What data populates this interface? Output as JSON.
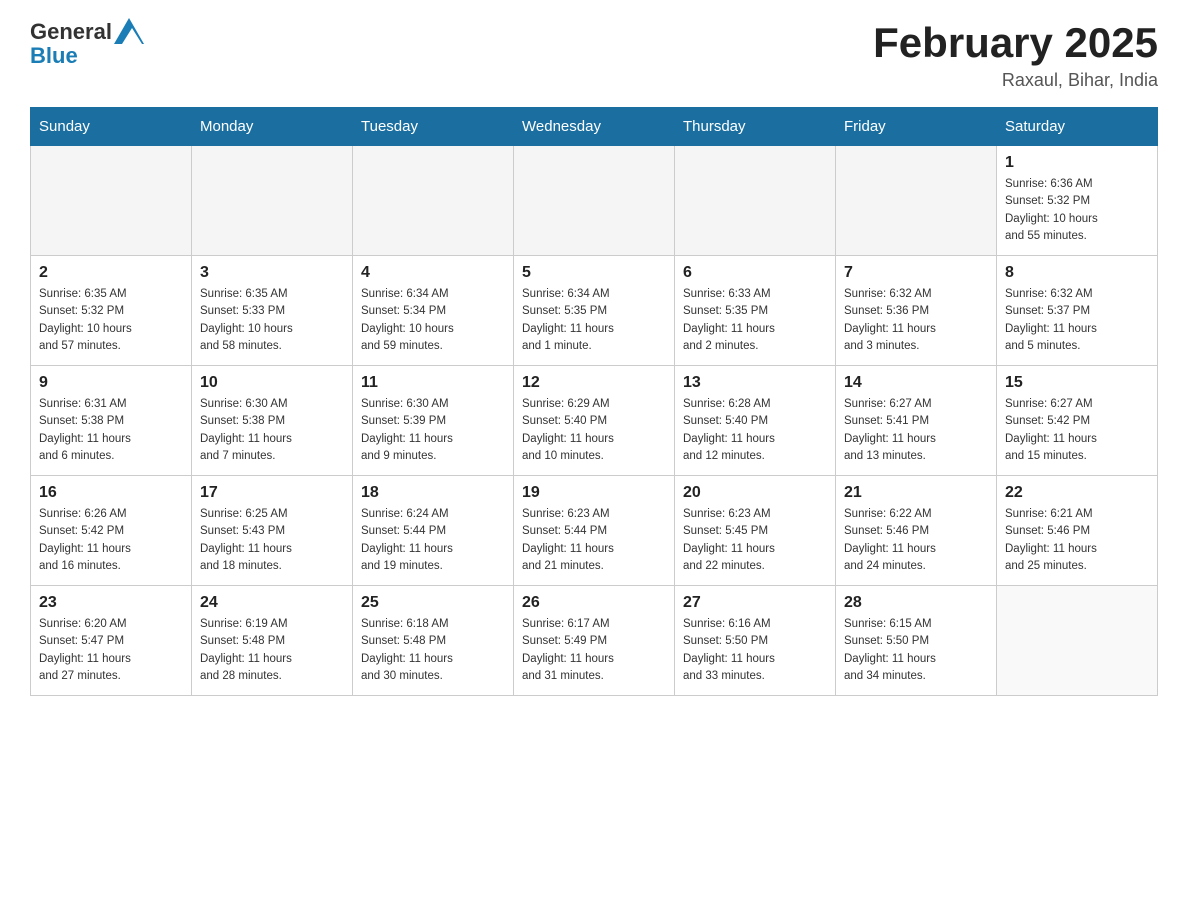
{
  "header": {
    "logo_general": "General",
    "logo_blue": "Blue",
    "title": "February 2025",
    "subtitle": "Raxaul, Bihar, India"
  },
  "days_of_week": [
    "Sunday",
    "Monday",
    "Tuesday",
    "Wednesday",
    "Thursday",
    "Friday",
    "Saturday"
  ],
  "weeks": [
    [
      {
        "day": "",
        "info": ""
      },
      {
        "day": "",
        "info": ""
      },
      {
        "day": "",
        "info": ""
      },
      {
        "day": "",
        "info": ""
      },
      {
        "day": "",
        "info": ""
      },
      {
        "day": "",
        "info": ""
      },
      {
        "day": "1",
        "info": "Sunrise: 6:36 AM\nSunset: 5:32 PM\nDaylight: 10 hours\nand 55 minutes."
      }
    ],
    [
      {
        "day": "2",
        "info": "Sunrise: 6:35 AM\nSunset: 5:32 PM\nDaylight: 10 hours\nand 57 minutes."
      },
      {
        "day": "3",
        "info": "Sunrise: 6:35 AM\nSunset: 5:33 PM\nDaylight: 10 hours\nand 58 minutes."
      },
      {
        "day": "4",
        "info": "Sunrise: 6:34 AM\nSunset: 5:34 PM\nDaylight: 10 hours\nand 59 minutes."
      },
      {
        "day": "5",
        "info": "Sunrise: 6:34 AM\nSunset: 5:35 PM\nDaylight: 11 hours\nand 1 minute."
      },
      {
        "day": "6",
        "info": "Sunrise: 6:33 AM\nSunset: 5:35 PM\nDaylight: 11 hours\nand 2 minutes."
      },
      {
        "day": "7",
        "info": "Sunrise: 6:32 AM\nSunset: 5:36 PM\nDaylight: 11 hours\nand 3 minutes."
      },
      {
        "day": "8",
        "info": "Sunrise: 6:32 AM\nSunset: 5:37 PM\nDaylight: 11 hours\nand 5 minutes."
      }
    ],
    [
      {
        "day": "9",
        "info": "Sunrise: 6:31 AM\nSunset: 5:38 PM\nDaylight: 11 hours\nand 6 minutes."
      },
      {
        "day": "10",
        "info": "Sunrise: 6:30 AM\nSunset: 5:38 PM\nDaylight: 11 hours\nand 7 minutes."
      },
      {
        "day": "11",
        "info": "Sunrise: 6:30 AM\nSunset: 5:39 PM\nDaylight: 11 hours\nand 9 minutes."
      },
      {
        "day": "12",
        "info": "Sunrise: 6:29 AM\nSunset: 5:40 PM\nDaylight: 11 hours\nand 10 minutes."
      },
      {
        "day": "13",
        "info": "Sunrise: 6:28 AM\nSunset: 5:40 PM\nDaylight: 11 hours\nand 12 minutes."
      },
      {
        "day": "14",
        "info": "Sunrise: 6:27 AM\nSunset: 5:41 PM\nDaylight: 11 hours\nand 13 minutes."
      },
      {
        "day": "15",
        "info": "Sunrise: 6:27 AM\nSunset: 5:42 PM\nDaylight: 11 hours\nand 15 minutes."
      }
    ],
    [
      {
        "day": "16",
        "info": "Sunrise: 6:26 AM\nSunset: 5:42 PM\nDaylight: 11 hours\nand 16 minutes."
      },
      {
        "day": "17",
        "info": "Sunrise: 6:25 AM\nSunset: 5:43 PM\nDaylight: 11 hours\nand 18 minutes."
      },
      {
        "day": "18",
        "info": "Sunrise: 6:24 AM\nSunset: 5:44 PM\nDaylight: 11 hours\nand 19 minutes."
      },
      {
        "day": "19",
        "info": "Sunrise: 6:23 AM\nSunset: 5:44 PM\nDaylight: 11 hours\nand 21 minutes."
      },
      {
        "day": "20",
        "info": "Sunrise: 6:23 AM\nSunset: 5:45 PM\nDaylight: 11 hours\nand 22 minutes."
      },
      {
        "day": "21",
        "info": "Sunrise: 6:22 AM\nSunset: 5:46 PM\nDaylight: 11 hours\nand 24 minutes."
      },
      {
        "day": "22",
        "info": "Sunrise: 6:21 AM\nSunset: 5:46 PM\nDaylight: 11 hours\nand 25 minutes."
      }
    ],
    [
      {
        "day": "23",
        "info": "Sunrise: 6:20 AM\nSunset: 5:47 PM\nDaylight: 11 hours\nand 27 minutes."
      },
      {
        "day": "24",
        "info": "Sunrise: 6:19 AM\nSunset: 5:48 PM\nDaylight: 11 hours\nand 28 minutes."
      },
      {
        "day": "25",
        "info": "Sunrise: 6:18 AM\nSunset: 5:48 PM\nDaylight: 11 hours\nand 30 minutes."
      },
      {
        "day": "26",
        "info": "Sunrise: 6:17 AM\nSunset: 5:49 PM\nDaylight: 11 hours\nand 31 minutes."
      },
      {
        "day": "27",
        "info": "Sunrise: 6:16 AM\nSunset: 5:50 PM\nDaylight: 11 hours\nand 33 minutes."
      },
      {
        "day": "28",
        "info": "Sunrise: 6:15 AM\nSunset: 5:50 PM\nDaylight: 11 hours\nand 34 minutes."
      },
      {
        "day": "",
        "info": ""
      }
    ]
  ]
}
